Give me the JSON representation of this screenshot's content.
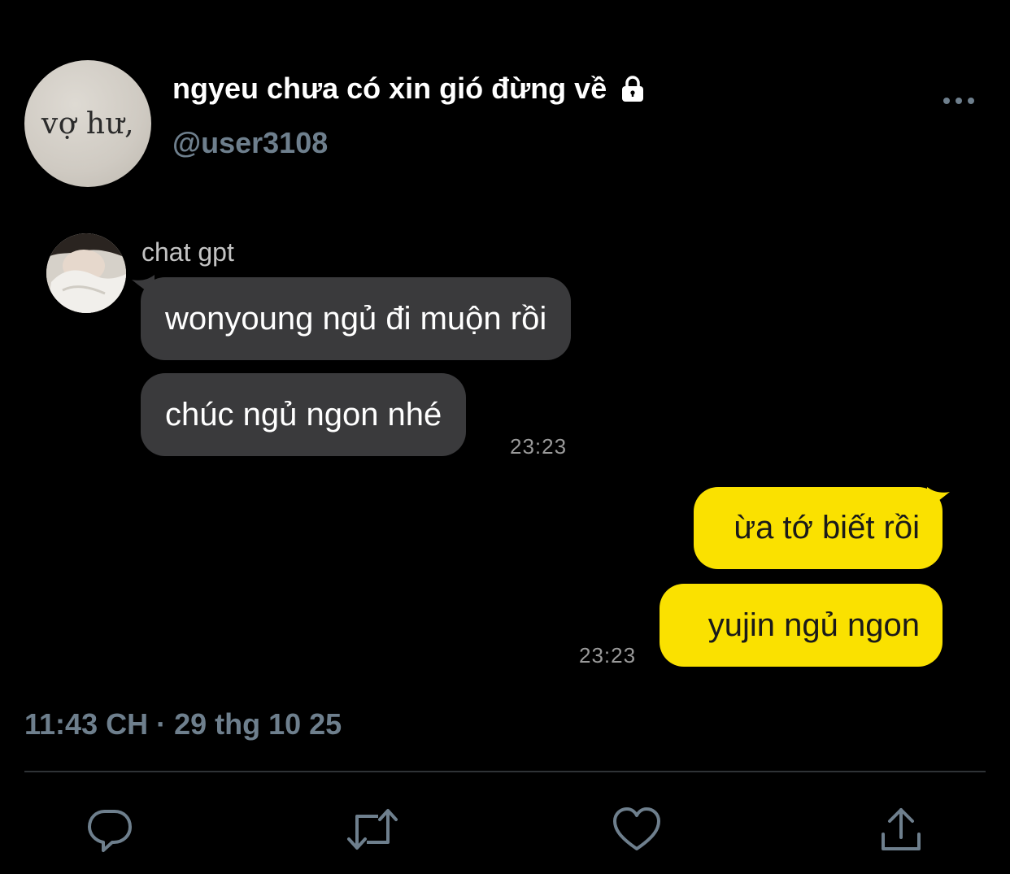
{
  "tweet": {
    "profile_avatar_text": "vợ hư,",
    "display_name": "ngyeu chưa có xin gió đừng về",
    "handle": "@user3108",
    "timestamp": "11:43 CH · 29 thg 10 25",
    "icons": {
      "lock": "lock-icon",
      "more": "more-horizontal-icon",
      "reply": "reply-icon",
      "retweet": "retweet-icon",
      "like": "heart-icon",
      "share": "share-icon"
    },
    "colors": {
      "background": "#000000",
      "secondary_text": "#6e7f8d",
      "divider": "#2f3336",
      "action_icon": "#6e7f8d"
    }
  },
  "chat": {
    "sender_name": "chat gpt",
    "incoming_messages": [
      {
        "text": "wonyoung ngủ đi muộn rồi"
      },
      {
        "text": "chúc ngủ ngon nhé"
      }
    ],
    "incoming_time": "23:23",
    "outgoing_messages": [
      {
        "text": "ừa tớ biết rồi"
      },
      {
        "text": "yujin ngủ ngon"
      }
    ],
    "outgoing_time": "23:23",
    "colors": {
      "incoming_bubble": "#3a3a3c",
      "outgoing_bubble": "#fae100"
    }
  }
}
